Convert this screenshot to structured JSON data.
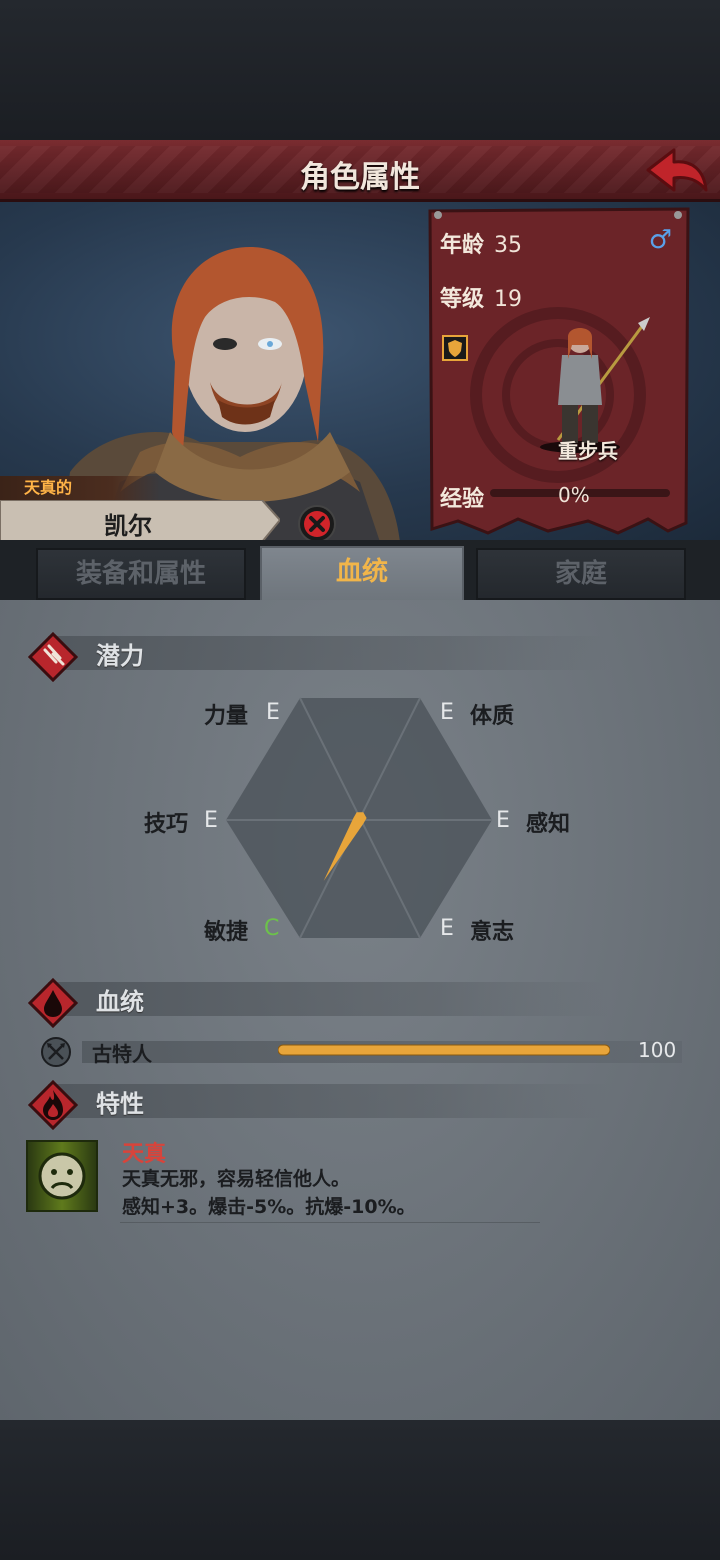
{
  "header": {
    "title": "角色属性"
  },
  "character": {
    "trait_adjective": "天真的",
    "name": "凯尔",
    "age_label": "年龄",
    "age": "35",
    "gender_symbol": "♂",
    "level_label": "等级",
    "level": "19",
    "class_name": "重步兵",
    "xp_label": "经验",
    "xp_percent": "0%",
    "xp_fraction": 0
  },
  "tabs": [
    {
      "label": "装备和属性",
      "active": false
    },
    {
      "label": "血统",
      "active": true
    },
    {
      "label": "家庭",
      "active": false
    }
  ],
  "potential": {
    "title": "潜力",
    "attributes": [
      {
        "name": "力量",
        "grade": "E"
      },
      {
        "name": "体质",
        "grade": "E"
      },
      {
        "name": "感知",
        "grade": "E"
      },
      {
        "name": "意志",
        "grade": "E"
      },
      {
        "name": "敏捷",
        "grade": "C"
      },
      {
        "name": "技巧",
        "grade": "E"
      }
    ]
  },
  "bloodline": {
    "title": "血统",
    "items": [
      {
        "name": "古特人",
        "value": "100",
        "fraction": 1.0
      }
    ]
  },
  "traits": {
    "title": "特性",
    "items": [
      {
        "name": "天真",
        "description": "天真无邪，容易轻信他人。",
        "effect": "感知+3。爆击-5%。抗爆-10%。"
      }
    ]
  },
  "colors": {
    "accent_gold": "#e8a53a",
    "header_red": "#6b2428",
    "grade_good": "#6cc24a",
    "trait_red": "#d8443b"
  }
}
